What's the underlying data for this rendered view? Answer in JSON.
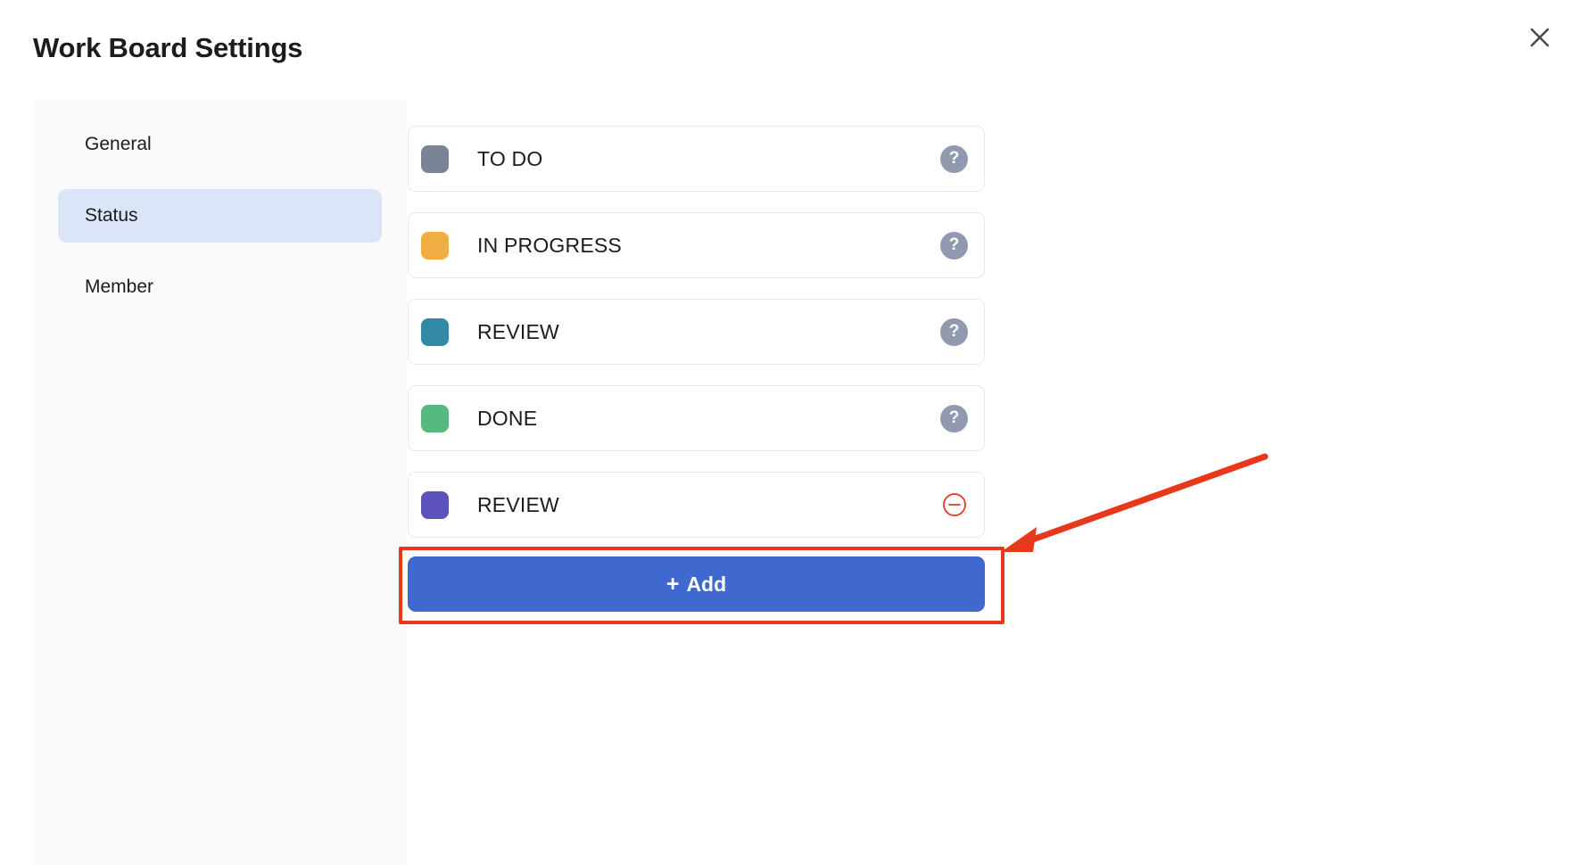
{
  "header": {
    "title": "Work Board Settings",
    "close_icon": "close-icon"
  },
  "sidebar": {
    "items": [
      {
        "label": "General",
        "active": false
      },
      {
        "label": "Status",
        "active": true
      },
      {
        "label": "Member",
        "active": false
      }
    ]
  },
  "main": {
    "statuses": [
      {
        "label": "TO DO",
        "color": "#7b8396",
        "action": "help",
        "action_icon": "question-mark-icon"
      },
      {
        "label": "IN PROGRESS",
        "color": "#f0ae42",
        "action": "help",
        "action_icon": "question-mark-icon"
      },
      {
        "label": "REVIEW",
        "color": "#3289a6",
        "action": "help",
        "action_icon": "question-mark-icon"
      },
      {
        "label": "DONE",
        "color": "#56b97f",
        "action": "help",
        "action_icon": "question-mark-icon"
      },
      {
        "label": "REVIEW",
        "color": "#5d52bd",
        "action": "remove",
        "action_icon": "minus-circle-icon"
      }
    ],
    "add_button": {
      "label": "Add",
      "plus": "+"
    }
  },
  "annotations": {
    "highlight_color": "#e8381c",
    "arrow": "arrow-pointing-to-add-button",
    "box": "highlight-box-around-add-button"
  },
  "colors": {
    "accent": "#4069cf",
    "sidebar_active": "#dae5f7",
    "sidebar_bg": "#fafafa",
    "annotation": "#e8381c"
  }
}
